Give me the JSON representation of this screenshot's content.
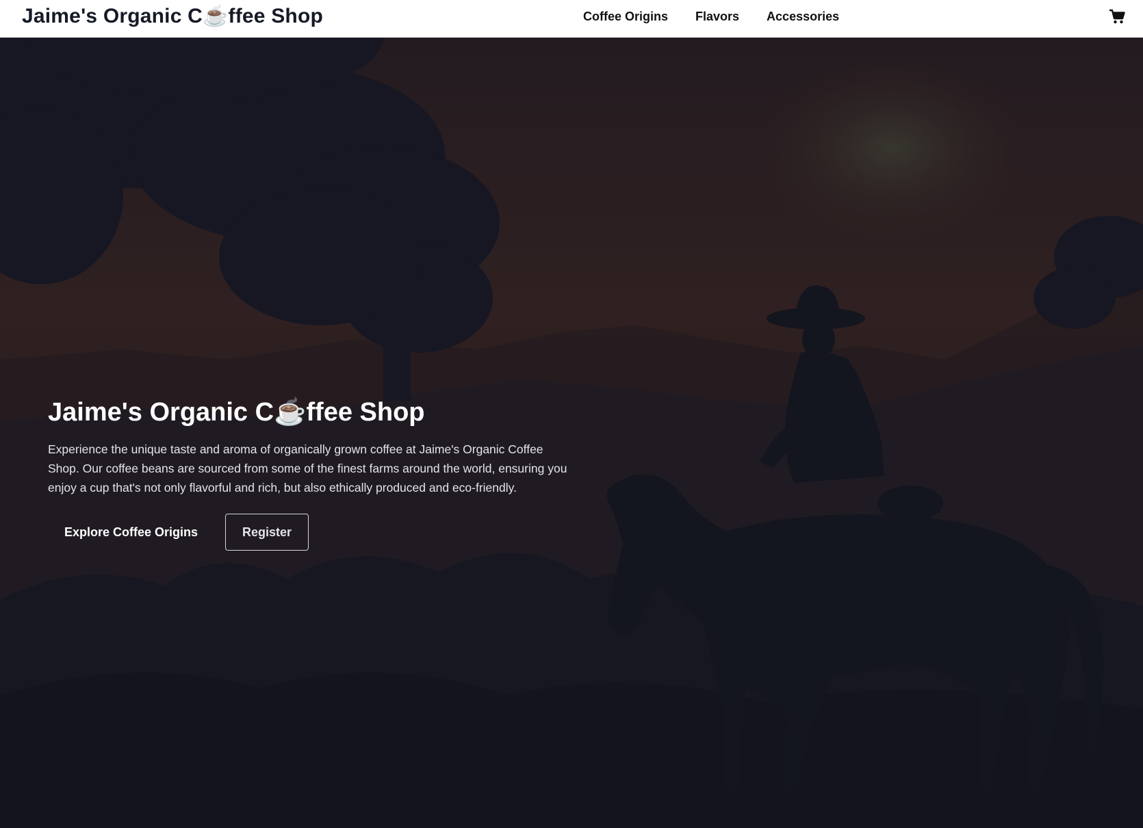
{
  "navbar": {
    "brand": "Jaime's Organic C☕ffee Shop",
    "links": [
      {
        "label": "Coffee Origins"
      },
      {
        "label": "Flavors"
      },
      {
        "label": "Accessories"
      }
    ],
    "cart_icon": "shopping-cart-icon"
  },
  "hero": {
    "title": "Jaime's Organic C☕ffee Shop",
    "description": "Experience the unique taste and aroma of organically grown coffee at Jaime's Organic Coffee Shop. Our coffee beans are sourced from some of the finest farms around the world, ensuring you enjoy a cup that's not only flavorful and rich, but also ethically produced and eco-friendly.",
    "primary_button": "Explore Coffee Origins",
    "secondary_button": "Register",
    "background_image": "silhouette of a cowboy on horseback among coffee hills at dusk"
  },
  "colors": {
    "navbar_bg": "#ffffff",
    "brand_text": "#161a26",
    "hero_overlay_top": "#3a2320",
    "hero_overlay_bottom": "#15161f",
    "hero_text": "#ffffff"
  }
}
